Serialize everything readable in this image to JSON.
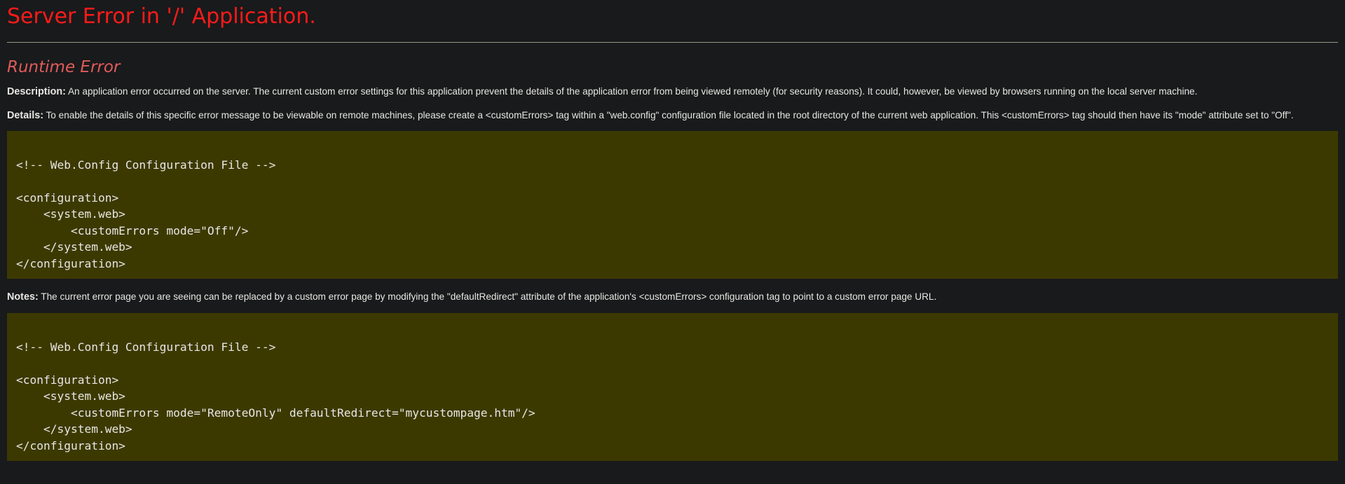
{
  "page": {
    "title": "Server Error in '/' Application.",
    "subtitle": "Runtime Error",
    "description": {
      "label": "Description:",
      "text": " An application error occurred on the server. The current custom error settings for this application prevent the details of the application error from being viewed remotely (for security reasons). It could, however, be viewed by browsers running on the local server machine."
    },
    "details": {
      "label": "Details:",
      "text": " To enable the details of this specific error message to be viewable on remote machines, please create a <customErrors> tag within a \"web.config\" configuration file located in the root directory of the current web application. This <customErrors> tag should then have its \"mode\" attribute set to \"Off\"."
    },
    "code_block_1": "\n<!-- Web.Config Configuration File -->\n\n<configuration>\n    <system.web>\n        <customErrors mode=\"Off\"/>\n    </system.web>\n</configuration>",
    "notes": {
      "label": "Notes:",
      "text": " The current error page you are seeing can be replaced by a custom error page by modifying the \"defaultRedirect\" attribute of the application's <customErrors> configuration tag to point to a custom error page URL."
    },
    "code_block_2": "\n<!-- Web.Config Configuration File -->\n\n<configuration>\n    <system.web>\n        <customErrors mode=\"RemoteOnly\" defaultRedirect=\"mycustompage.htm\"/>\n    </system.web>\n</configuration>"
  },
  "colors": {
    "background": "#181a1b",
    "title": "#ff1a1a",
    "subtitle": "#e15a5a",
    "text": "#e8e6e3",
    "code_background": "#3c3900"
  }
}
